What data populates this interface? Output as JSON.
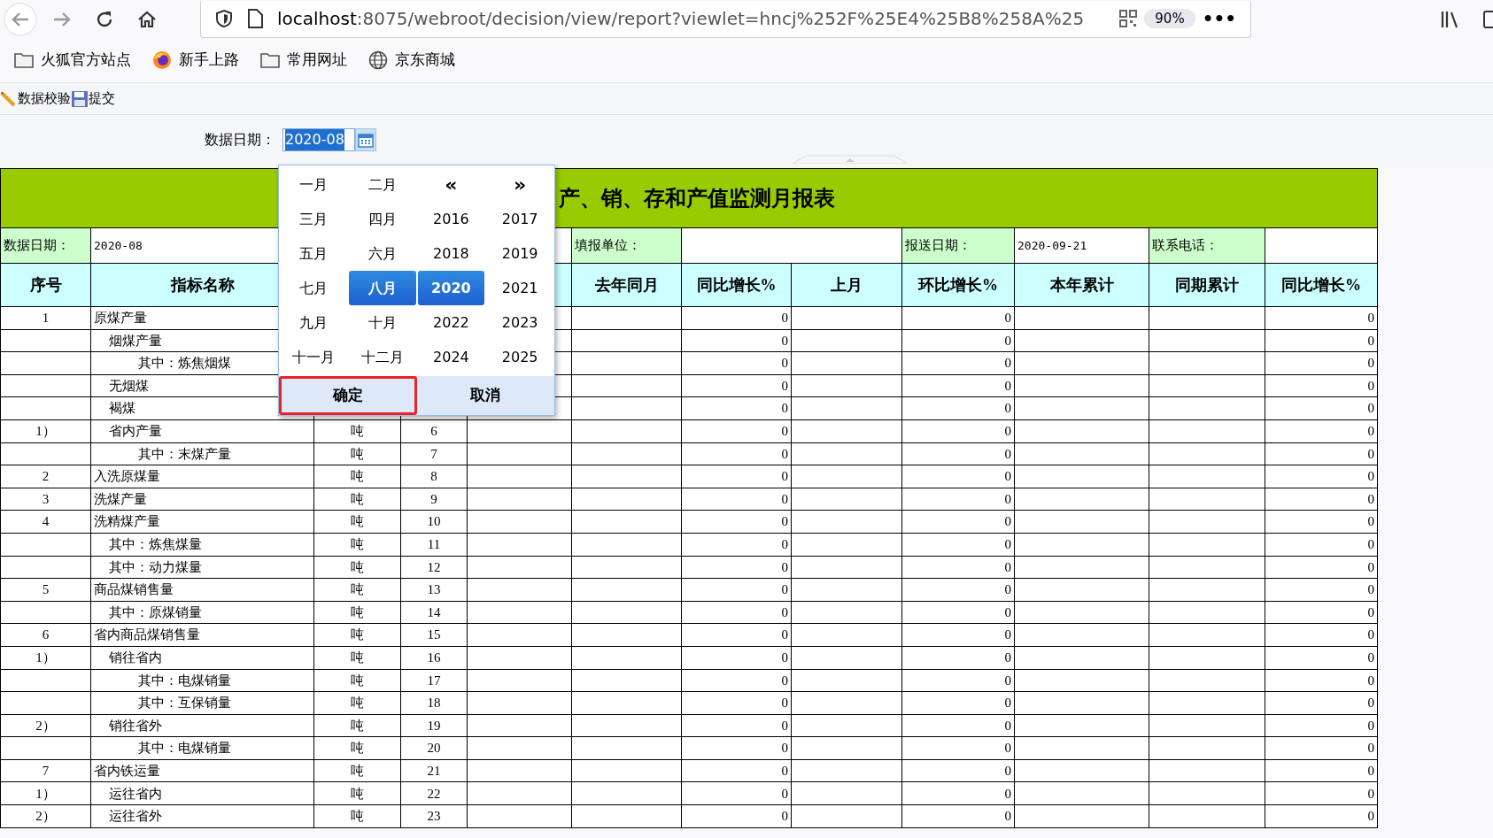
{
  "browser": {
    "url_host": "localhost",
    "url_path": ":8075/webroot/decision/view/report?viewlet=hncj%252F%25E4%25B8%258A%25",
    "zoom": "90%",
    "more": "•••"
  },
  "bookmarks": [
    {
      "label": "火狐官方站点",
      "kind": "folder"
    },
    {
      "label": "新手上路",
      "kind": "firefox"
    },
    {
      "label": "常用网址",
      "kind": "folder"
    },
    {
      "label": "京东商城",
      "kind": "globe"
    }
  ],
  "toolbar": [
    {
      "label": "数据校验",
      "kind": "edit"
    },
    {
      "label": "提交",
      "kind": "save"
    }
  ],
  "parameter": {
    "label": "数据日期：",
    "value": "2020-08",
    "text_selected": true
  },
  "picker": {
    "prev": "«",
    "next": "»",
    "months": [
      {
        "label": "一月",
        "selected": false
      },
      {
        "label": "二月",
        "selected": false
      },
      {
        "label": "三月",
        "selected": false
      },
      {
        "label": "四月",
        "selected": false
      },
      {
        "label": "五月",
        "selected": false
      },
      {
        "label": "六月",
        "selected": false
      },
      {
        "label": "七月",
        "selected": false
      },
      {
        "label": "八月",
        "selected": true
      },
      {
        "label": "九月",
        "selected": false
      },
      {
        "label": "十月",
        "selected": false
      },
      {
        "label": "十一月",
        "selected": false
      },
      {
        "label": "十二月",
        "selected": false
      }
    ],
    "years": [
      {
        "label": "2016",
        "selected": false
      },
      {
        "label": "2017",
        "selected": false
      },
      {
        "label": "2018",
        "selected": false
      },
      {
        "label": "2019",
        "selected": false
      },
      {
        "label": "2020",
        "selected": true
      },
      {
        "label": "2021",
        "selected": false
      },
      {
        "label": "2022",
        "selected": false
      },
      {
        "label": "2023",
        "selected": false
      },
      {
        "label": "2024",
        "selected": false
      },
      {
        "label": "2025",
        "selected": false
      }
    ],
    "buttons": [
      {
        "label": "确定",
        "outlined": true
      },
      {
        "label": "取消",
        "outlined": false
      }
    ]
  },
  "report": {
    "title": "产、销、存和产值监测月报表",
    "info": [
      {
        "label": "数据日期：",
        "value": "2020-08"
      },
      {
        "label": "填报单位："
      },
      {
        "label": "报送日期：",
        "value": "2020-09-21"
      },
      {
        "label": "联系电话："
      }
    ],
    "columns": [
      "序号",
      "指标名称",
      "去年同月",
      "同比增长%",
      "上月",
      "环比增长%",
      "本年累计",
      "同期累计",
      "同比增长%"
    ],
    "rows": [
      {
        "seq": "1",
        "name": "原煤产量",
        "values": {
          "yoy": "0",
          "mom": "0",
          "cum_yoy": "0"
        },
        "children": [
          {
            "name": "烟煤产量",
            "values": {
              "yoy": "0",
              "mom": "0",
              "cum_yoy": "0"
            },
            "children": [
              {
                "name": "其中：炼焦烟煤",
                "values": {
                  "yoy": "0",
                  "mom": "0",
                  "cum_yoy": "0"
                }
              }
            ]
          },
          {
            "name": "无烟煤",
            "values": {
              "yoy": "0",
              "mom": "0",
              "cum_yoy": "0"
            }
          },
          {
            "name": "褐煤",
            "values": {
              "yoy": "0",
              "mom": "0",
              "cum_yoy": "0"
            }
          },
          {
            "seq": "1）",
            "name": "省内产量",
            "unit": "吨",
            "code": "6",
            "values": {
              "yoy": "0",
              "mom": "0",
              "cum_yoy": "0"
            },
            "children": [
              {
                "name": "其中：末煤产量",
                "unit": "吨",
                "code": "7",
                "values": {
                  "yoy": "0",
                  "mom": "0",
                  "cum_yoy": "0"
                }
              }
            ]
          }
        ]
      },
      {
        "seq": "2",
        "name": "入洗原煤量",
        "unit": "吨",
        "code": "8",
        "values": {
          "yoy": "0",
          "mom": "0",
          "cum_yoy": "0"
        }
      },
      {
        "seq": "3",
        "name": "洗煤产量",
        "unit": "吨",
        "code": "9",
        "values": {
          "yoy": "0",
          "mom": "0",
          "cum_yoy": "0"
        }
      },
      {
        "seq": "4",
        "name": "洗精煤产量",
        "unit": "吨",
        "code": "10",
        "values": {
          "yoy": "0",
          "mom": "0",
          "cum_yoy": "0"
        },
        "children": [
          {
            "name": "其中：炼焦煤量",
            "unit": "吨",
            "code": "11",
            "values": {
              "yoy": "0",
              "mom": "0",
              "cum_yoy": "0"
            }
          },
          {
            "name": "其中：动力煤量",
            "unit": "吨",
            "code": "12",
            "values": {
              "yoy": "0",
              "mom": "0",
              "cum_yoy": "0"
            }
          }
        ]
      },
      {
        "seq": "5",
        "name": "商品煤销售量",
        "unit": "吨",
        "code": "13",
        "values": {
          "yoy": "0",
          "mom": "0",
          "cum_yoy": "0"
        },
        "children": [
          {
            "name": "其中：原煤销量",
            "unit": "吨",
            "code": "14",
            "values": {
              "yoy": "0",
              "mom": "0",
              "cum_yoy": "0"
            }
          }
        ]
      },
      {
        "seq": "6",
        "name": "省内商品煤销售量",
        "unit": "吨",
        "code": "15",
        "values": {
          "yoy": "0",
          "mom": "0",
          "cum_yoy": "0"
        },
        "children": [
          {
            "seq": "1）",
            "name": "销往省内",
            "unit": "吨",
            "code": "16",
            "values": {
              "yoy": "0",
              "mom": "0",
              "cum_yoy": "0"
            },
            "children": [
              {
                "name": "其中：电煤销量",
                "unit": "吨",
                "code": "17",
                "values": {
                  "yoy": "0",
                  "mom": "0",
                  "cum_yoy": "0"
                }
              },
              {
                "name": "其中：互保销量",
                "unit": "吨",
                "code": "18",
                "values": {
                  "yoy": "0",
                  "mom": "0",
                  "cum_yoy": "0"
                }
              }
            ]
          },
          {
            "seq": "2）",
            "name": "销往省外",
            "unit": "吨",
            "code": "19",
            "values": {
              "yoy": "0",
              "mom": "0",
              "cum_yoy": "0"
            },
            "children": [
              {
                "name": "其中：电煤销量",
                "unit": "吨",
                "code": "20",
                "values": {
                  "yoy": "0",
                  "mom": "0",
                  "cum_yoy": "0"
                }
              }
            ]
          }
        ]
      },
      {
        "seq": "7",
        "name": "省内铁运量",
        "unit": "吨",
        "code": "21",
        "values": {
          "yoy": "0",
          "mom": "0",
          "cum_yoy": "0"
        },
        "children": [
          {
            "seq": "1）",
            "name": "运往省内",
            "unit": "吨",
            "code": "22",
            "values": {
              "yoy": "0",
              "mom": "0",
              "cum_yoy": "0"
            }
          },
          {
            "seq": "2）",
            "name": "运往省外",
            "unit": "吨",
            "code": "23",
            "values": {
              "yoy": "0",
              "mom": "0",
              "cum_yoy": "0"
            }
          }
        ]
      }
    ]
  }
}
